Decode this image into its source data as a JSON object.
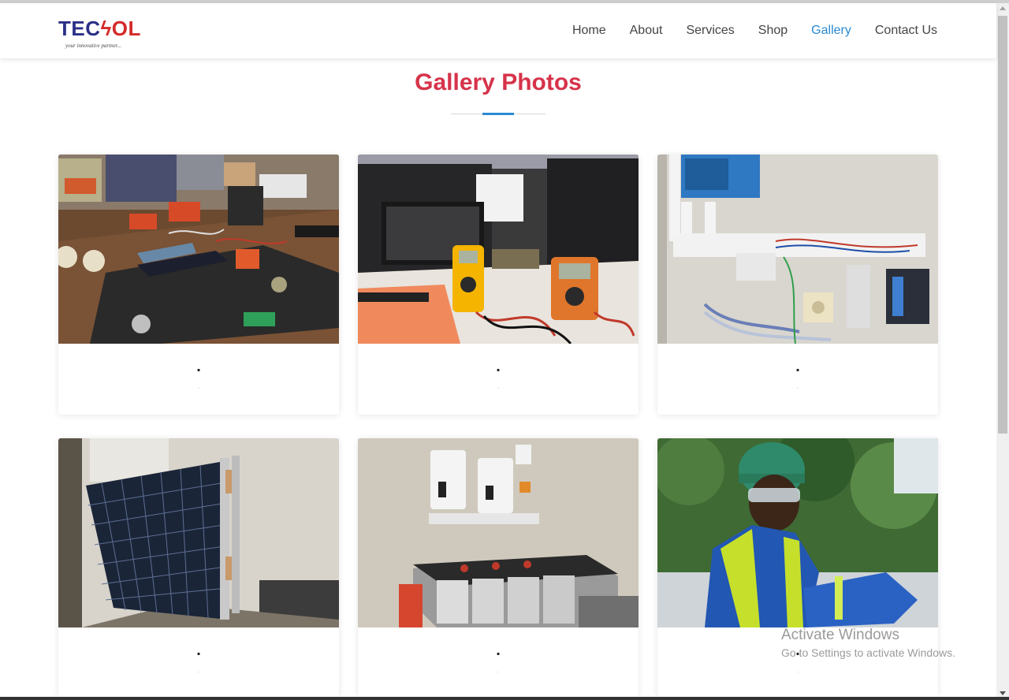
{
  "brand": {
    "logo_left": "TEC",
    "logo_bolt": "ϟ",
    "logo_right": "OL",
    "tagline": "your innovative partner..."
  },
  "nav": {
    "items": [
      {
        "label": "Home",
        "active": false
      },
      {
        "label": "About",
        "active": false
      },
      {
        "label": "Services",
        "active": false
      },
      {
        "label": "Shop",
        "active": false
      },
      {
        "label": "Gallery",
        "active": true
      },
      {
        "label": "Contact Us",
        "active": false
      }
    ]
  },
  "page": {
    "title": "Gallery Photos"
  },
  "gallery": {
    "cards": [
      {
        "title": ".",
        "subtitle": "."
      },
      {
        "title": ".",
        "subtitle": "."
      },
      {
        "title": ".",
        "subtitle": "."
      },
      {
        "title": ".",
        "subtitle": "."
      },
      {
        "title": ".",
        "subtitle": "."
      },
      {
        "title": ".",
        "subtitle": "."
      }
    ]
  },
  "watermark": {
    "line1": "Activate Windows",
    "line2": "Go to Settings to activate Windows."
  },
  "colors": {
    "brand_blue": "#2a2f86",
    "brand_red": "#d42a2a",
    "title_red": "#d6334a",
    "active_link": "#2a8ad3"
  }
}
